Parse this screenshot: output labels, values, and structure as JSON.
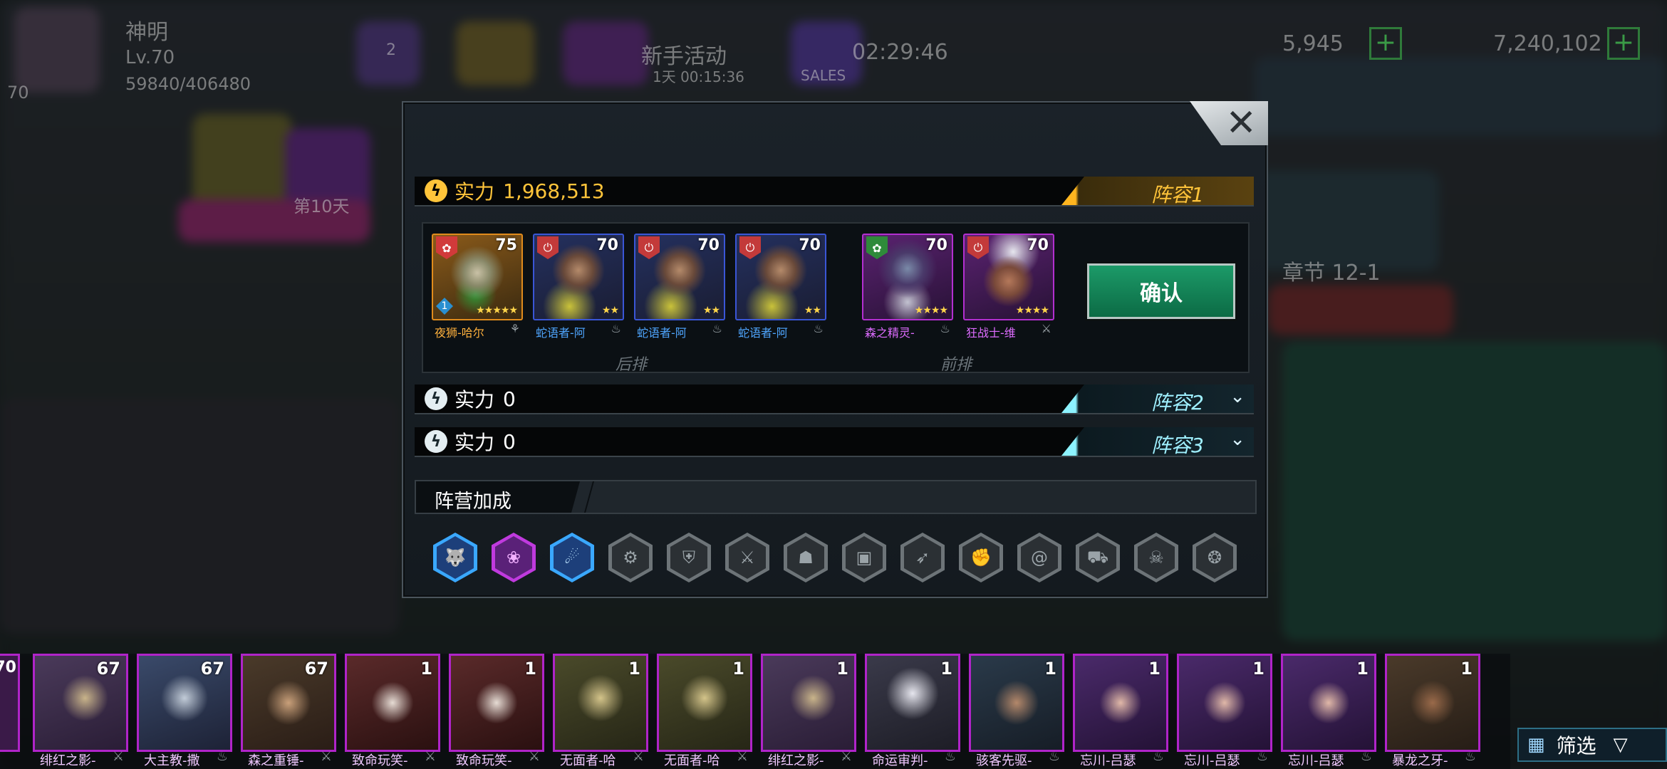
{
  "background": {
    "player_name": "神明",
    "level": "Lv.70",
    "exp": "59840/406480",
    "event": "新手活动",
    "event_timer": "1天 00:15:36",
    "timer": "02:29:46",
    "sales": "SALES",
    "currency1": "5,945",
    "currency2": "7,240,102",
    "level_badge": "70",
    "badge_2": "2",
    "day_text": "第10天",
    "stage": "章节 12-1"
  },
  "dialog": {
    "close_glyph": "✕",
    "team1": {
      "power_label": "实力",
      "power_value": "1,968,513",
      "tab_label": "阵容1"
    },
    "team2": {
      "power_label": "实力",
      "power_value": "0",
      "tab_label": "阵容2"
    },
    "team3": {
      "power_label": "实力",
      "power_value": "0",
      "tab_label": "阵容3"
    },
    "heroes": [
      {
        "name": "夜狮-哈尔",
        "level": "75",
        "stars": "★★★★★",
        "rank": "1",
        "color": "#e08b1c",
        "name_color": "#ffb13d"
      },
      {
        "name": "蛇语者-阿",
        "level": "70",
        "stars": "★★",
        "color": "#3a56d6",
        "name_color": "#4fa6ff"
      },
      {
        "name": "蛇语者-阿",
        "level": "70",
        "stars": "★★",
        "color": "#3a56d6",
        "name_color": "#4fa6ff"
      },
      {
        "name": "蛇语者-阿",
        "level": "70",
        "stars": "★★",
        "color": "#3a56d6",
        "name_color": "#4fa6ff"
      },
      {
        "name": "森之精灵-",
        "level": "70",
        "stars": "★★★★",
        "color": "#b32fd0",
        "name_color": "#de6cff"
      },
      {
        "name": "狂战士-维",
        "level": "70",
        "stars": "★★★★",
        "color": "#b32fd0",
        "name_color": "#de6cff"
      }
    ],
    "back_row_label": "后排",
    "front_row_label": "前排",
    "confirm_label": "确认",
    "faction_title": "阵营加成",
    "faction_icons": [
      "wolf-faction-icon",
      "lotus-faction-icon",
      "eagle-faction-icon",
      "gear-faction-icon",
      "shield-faction-icon",
      "blade-faction-icon",
      "mask-faction-icon",
      "box-faction-icon",
      "chevron-faction-icon",
      "fist-faction-icon",
      "spiral-faction-icon",
      "tank-faction-icon",
      "skull-faction-icon",
      "dragon-faction-icon"
    ]
  },
  "roster": [
    {
      "name": "绯红之影-",
      "level": "67"
    },
    {
      "name": "大主教-撒",
      "level": "67"
    },
    {
      "name": "森之重锤-",
      "level": "67"
    },
    {
      "name": "致命玩笑-",
      "level": "1"
    },
    {
      "name": "致命玩笑-",
      "level": "1"
    },
    {
      "name": "无面者-哈",
      "level": "1"
    },
    {
      "name": "无面者-哈",
      "level": "1"
    },
    {
      "name": "绯红之影-",
      "level": "1"
    },
    {
      "name": "命运审判-",
      "level": "1"
    },
    {
      "name": "骇客先驱-",
      "level": "1"
    },
    {
      "name": "忘川-吕瑟",
      "level": "1"
    },
    {
      "name": "忘川-吕瑟",
      "level": "1"
    },
    {
      "name": "忘川-吕瑟",
      "level": "1"
    },
    {
      "name": "暴龙之牙-",
      "level": "1"
    }
  ],
  "roster_edge_level": "70",
  "filter_label": "筛选",
  "colors": {
    "gold": "#ffc43a",
    "cyan": "#9ff0ff",
    "confirm_green": "#13885a",
    "epic_purple": "#b024c9"
  }
}
